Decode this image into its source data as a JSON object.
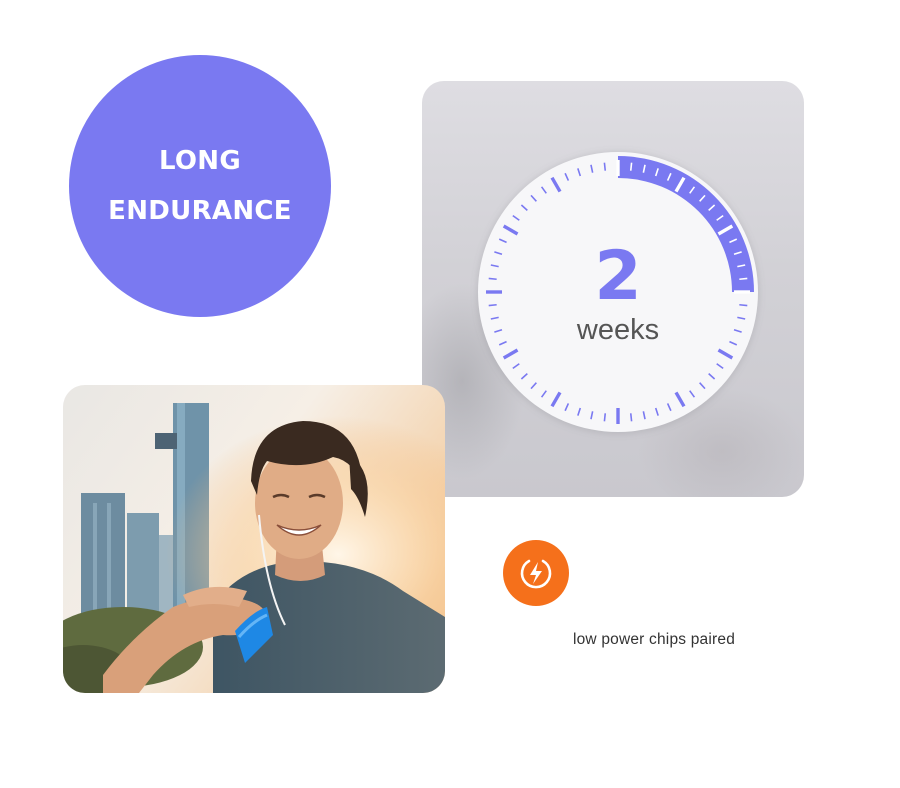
{
  "badge": {
    "line1": "LONG",
    "line2": "ENDURANCE",
    "color": "#7a79f1"
  },
  "dial": {
    "value": "2",
    "unit": "weeks",
    "progress_fraction": 0.25,
    "accent_color": "#7a79f1",
    "ticks": 60
  },
  "photo": {
    "subject": "smiling man looking at blue fitness band on wrist"
  },
  "power": {
    "icon": "lightning-bolt-icon",
    "caption": "low power chips paired",
    "color": "#f5701b"
  }
}
